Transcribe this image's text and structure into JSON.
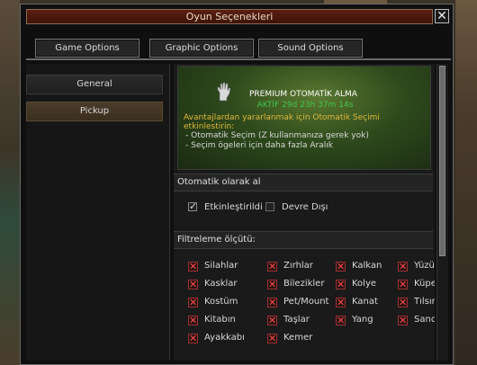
{
  "window": {
    "title": "Oyun Seçenekleri",
    "close_glyph": "✕"
  },
  "tabs": [
    "Game Options",
    "Graphic Options",
    "Sound Options"
  ],
  "sidebar": {
    "items": [
      {
        "label": "General"
      },
      {
        "label": "Pickup"
      }
    ]
  },
  "premium": {
    "title": "PREMIUM OTOMATİK ALMA",
    "status": "AKTİF 29d 23h 37m 14s",
    "description": "Avantajlardan yararlanmak için Otomatik Seçimi etkinlestirin:",
    "bullets": [
      "- Otomatik Seçim (Z kullanmanıza gerek yok)",
      "- Seçim ögeleri için daha fazla Aralık"
    ],
    "icon": "hand-icon"
  },
  "auto_pick": {
    "header": "Otomatik olarak al",
    "options": [
      {
        "label": "Etkinleştirildi",
        "checked": true
      },
      {
        "label": "Devre Dışı",
        "checked": false
      }
    ]
  },
  "filter": {
    "header": "Filtreleme ölçütü:",
    "mark_glyph": "✕",
    "items": [
      [
        "Silahlar",
        "Zırhlar",
        "Kalkan",
        "Yüzük"
      ],
      [
        "Kasklar",
        "Bilezikler",
        "Kolye",
        "Küpeler"
      ],
      [
        "Kostüm",
        "Pet/Mount",
        "Kanat",
        "Tılsım"
      ],
      [
        "Kitabın",
        "Taşlar",
        "Yang",
        "Sandıklar"
      ],
      [
        "Ayakkabı",
        "Kemer"
      ]
    ]
  },
  "colors": {
    "accent_title": "#5a1f10",
    "status_green": "#3fc64a",
    "desc_gold": "#e0b83a",
    "filter_x_red": "#ff4a4a"
  }
}
